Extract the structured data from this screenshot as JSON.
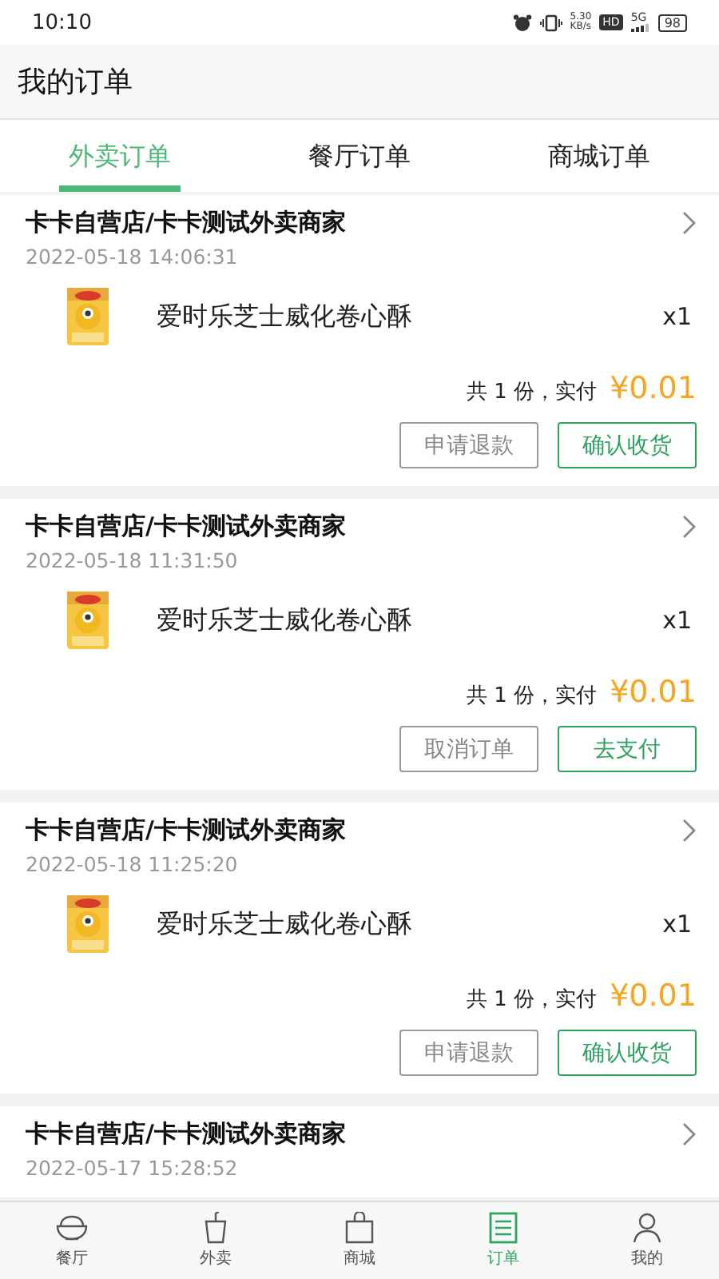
{
  "status_bar": {
    "time": "10:10",
    "speed_value": "5.30",
    "speed_unit": "KB/s",
    "hd": "HD",
    "network": "5G",
    "battery": "98"
  },
  "header": {
    "title": "我的订单"
  },
  "tabs": [
    {
      "label": "外卖订单",
      "selected": true
    },
    {
      "label": "餐厅订单",
      "selected": false
    },
    {
      "label": "商城订单",
      "selected": false
    }
  ],
  "orders": [
    {
      "store": "卡卡自营店/卡卡测试外卖商家",
      "time": "2022-05-18  14:06:31",
      "items": [
        {
          "kind": "picture",
          "name": "爱时乐芝士威化卷心酥",
          "quantity": "x1"
        }
      ],
      "summary": "共 1 份，实付",
      "price": "¥0.01",
      "buttons": [
        {
          "label": "申请退款",
          "kind": "secondary"
        },
        {
          "label": "确认收货",
          "kind": "primary"
        }
      ]
    },
    {
      "store": "卡卡自营店/卡卡测试外卖商家",
      "time": "2022-05-18  11:31:50",
      "items": [
        {
          "kind": "picture",
          "name": "爱时乐芝士威化卷心酥",
          "quantity": "x1"
        }
      ],
      "summary": "共 1 份，实付",
      "price": "¥0.01",
      "buttons": [
        {
          "label": "取消订单",
          "kind": "secondary"
        },
        {
          "label": "去支付",
          "kind": "primary"
        }
      ]
    },
    {
      "store": "卡卡自营店/卡卡测试外卖商家",
      "time": "2022-05-18  11:25:20",
      "items": [
        {
          "kind": "picture",
          "name": "爱时乐芝士威化卷心酥",
          "quantity": "x1"
        }
      ],
      "summary": "共 1 份，实付",
      "price": "¥0.01",
      "buttons": [
        {
          "label": "申请退款",
          "kind": "secondary"
        },
        {
          "label": "确认收货",
          "kind": "primary"
        }
      ]
    },
    {
      "store": "卡卡自营店/卡卡测试外卖商家",
      "time": "2022-05-17  15:28:52"
    }
  ],
  "bottom_nav": [
    {
      "label": "餐厅",
      "kind": "bowl",
      "selected": false
    },
    {
      "label": "外卖",
      "kind": "cup",
      "selected": false
    },
    {
      "label": "商城",
      "kind": "bag",
      "selected": false
    },
    {
      "label": "订单",
      "kind": "list",
      "selected": true
    },
    {
      "label": "我的",
      "kind": "person",
      "selected": false
    }
  ]
}
